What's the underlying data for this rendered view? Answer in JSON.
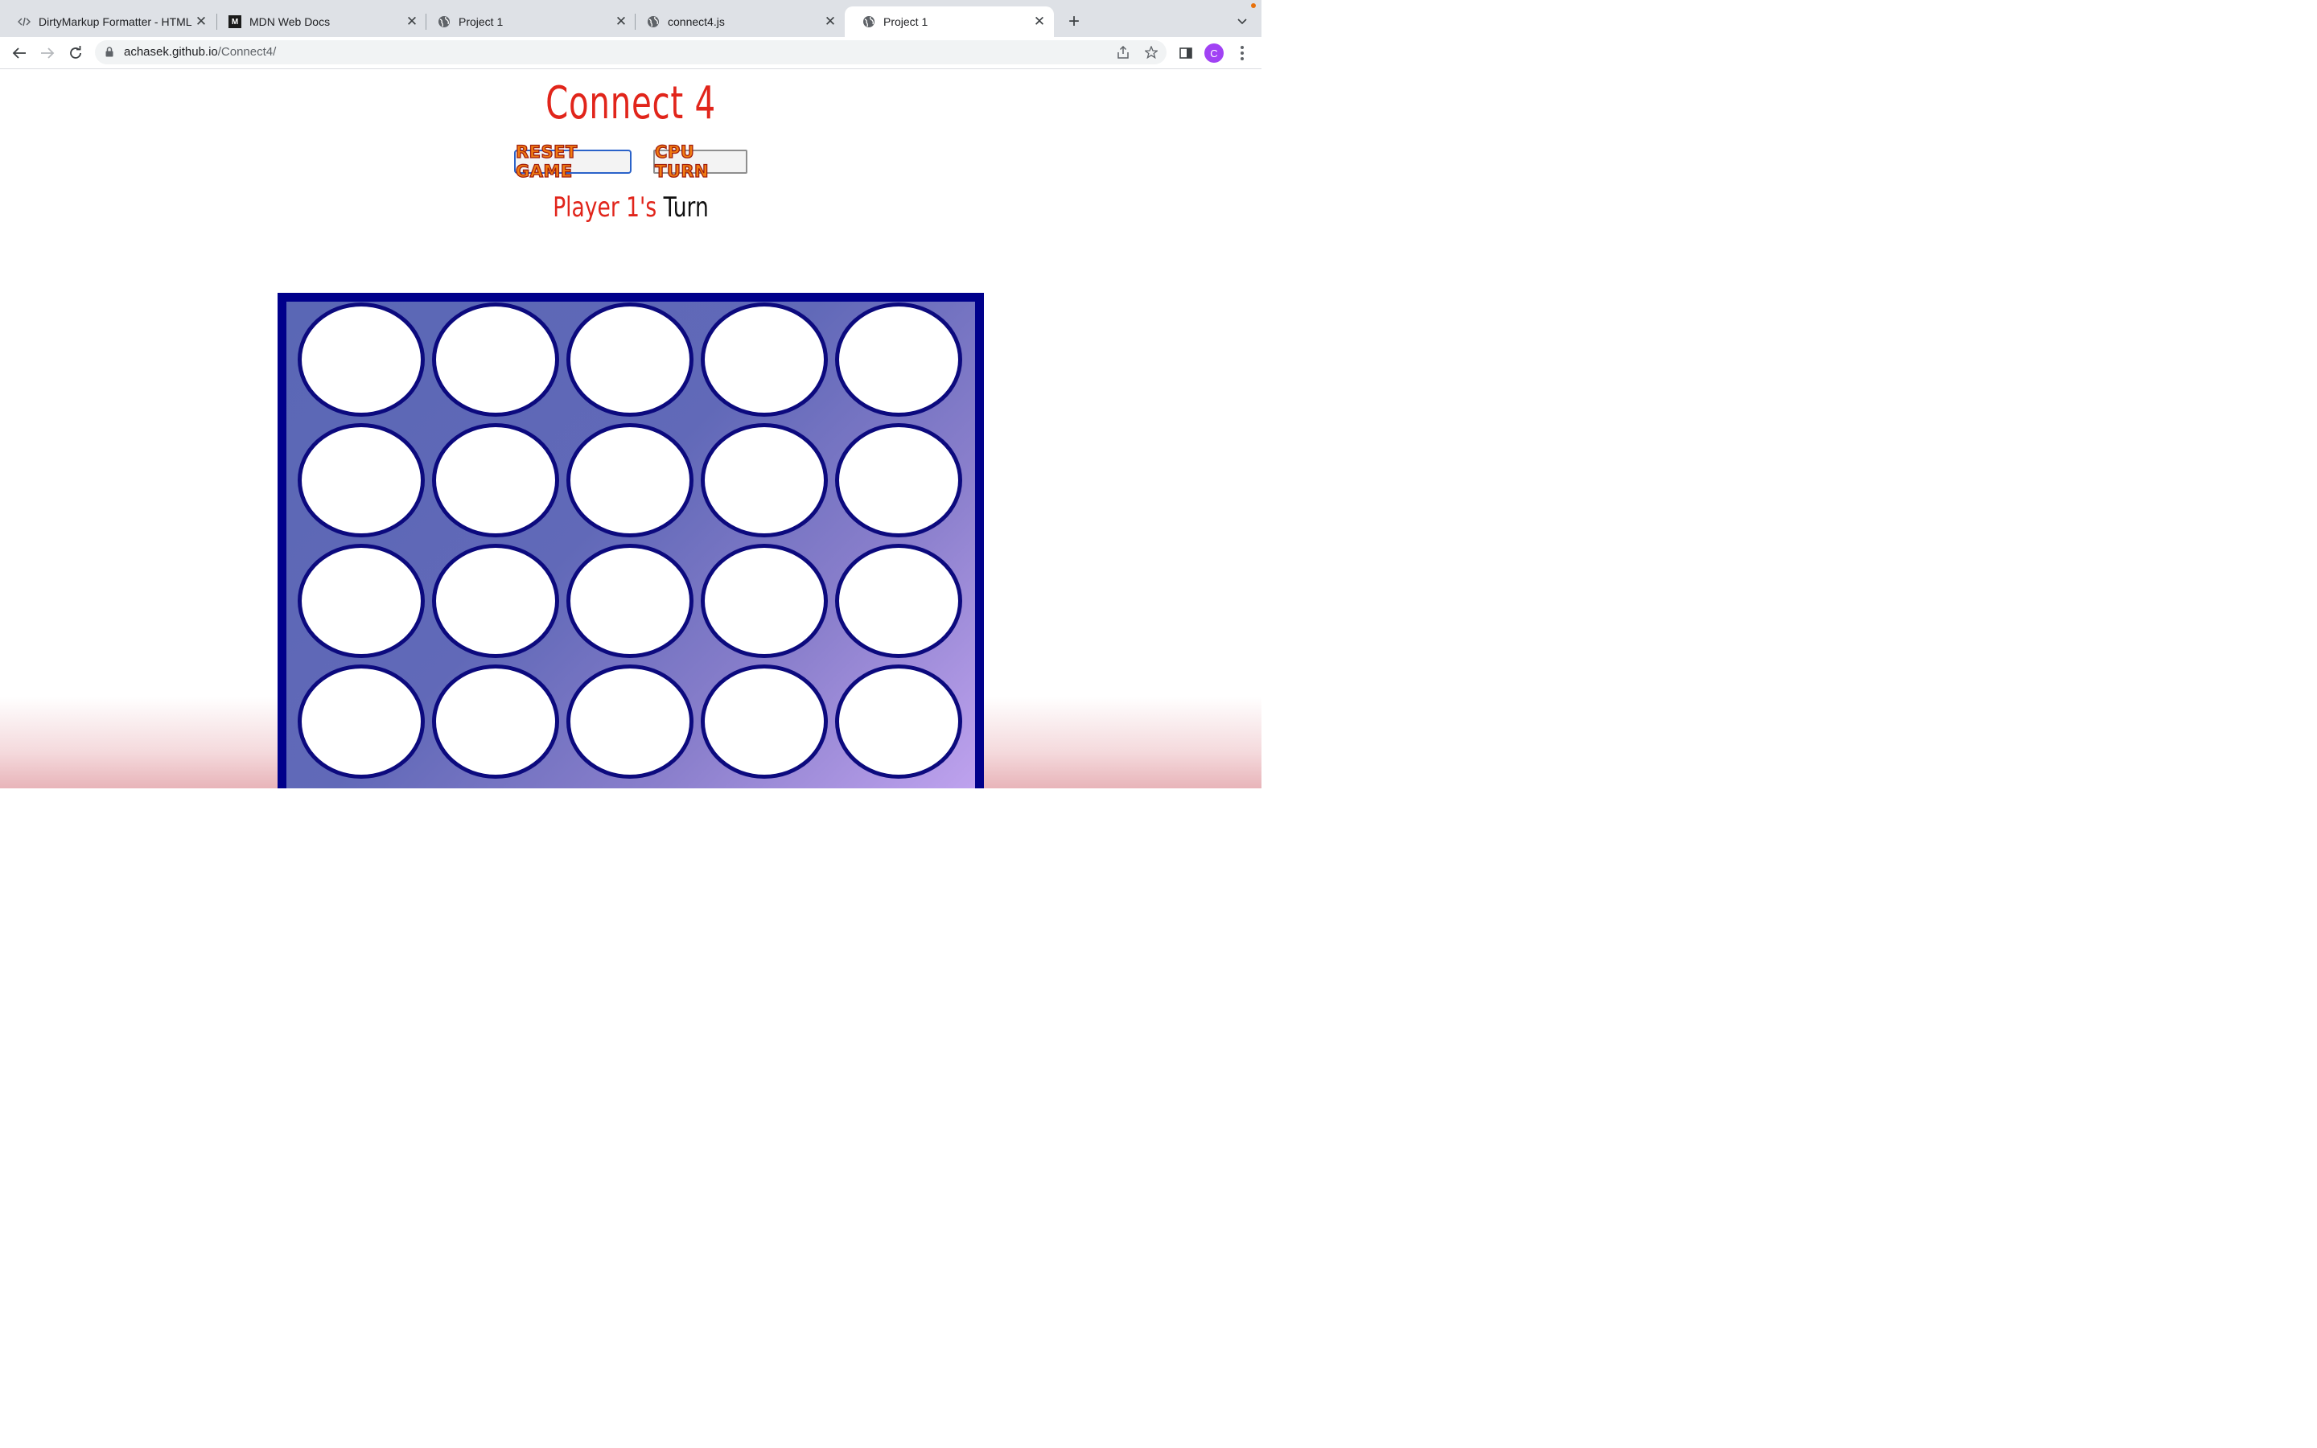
{
  "browser": {
    "tabs": [
      {
        "title": "DirtyMarkup Formatter - HTML",
        "favicon": "code-icon",
        "active": false
      },
      {
        "title": "MDN Web Docs",
        "favicon": "mdn-icon",
        "active": false
      },
      {
        "title": "Project 1",
        "favicon": "globe-icon",
        "active": false
      },
      {
        "title": "connect4.js",
        "favicon": "globe-icon",
        "active": false
      },
      {
        "title": "Project 1",
        "favicon": "globe-icon",
        "active": true
      }
    ],
    "address": {
      "host": "achasek.github.io",
      "path": "/Connect4/"
    },
    "profile_initial": "C"
  },
  "game": {
    "title": "Connect 4",
    "buttons": {
      "reset": "RESET GAME",
      "cpu": "CPU TURN"
    },
    "turn": {
      "player": "Player 1's",
      "rest": "Turn"
    },
    "board": {
      "rows": 4,
      "columns": 5,
      "visible_cells": 20,
      "all_empty": true
    }
  },
  "colors": {
    "title": "#e1251b",
    "board_border": "#00008b",
    "board_fill_start": "#5a67b5",
    "board_fill_end": "#c0a3ef",
    "slot_border": "#0c0a7e",
    "slot_fill": "#ffffff",
    "button_text": "#f07c11"
  }
}
